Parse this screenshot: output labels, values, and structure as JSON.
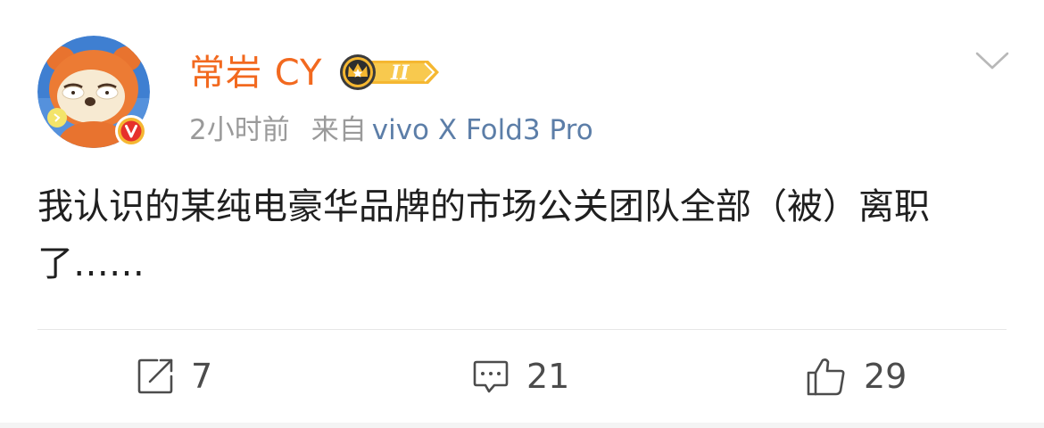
{
  "post": {
    "username": "常岩 CY",
    "member_badge": {
      "level": "II",
      "icon": "crown-icon",
      "color": "#f5b731"
    },
    "verified_badge": {
      "icon": "v-verified-icon",
      "label": "V",
      "color": "#e6312c"
    },
    "time": "2小时前",
    "source_prefix": "来自",
    "source_device": "vivo X Fold3 Pro",
    "content": "我认识的某纯电豪华品牌的市场公关团队全部（被）离职了……",
    "menu_icon": "chevron-down-icon"
  },
  "actions": {
    "repost": {
      "icon": "repost-icon",
      "count": "7"
    },
    "comment": {
      "icon": "comment-icon",
      "count": "21"
    },
    "like": {
      "icon": "thumbs-up-icon",
      "count": "29"
    }
  },
  "colors": {
    "username": "#f2691f",
    "device": "#5c7ea8",
    "meta": "#9a9a9a",
    "text": "#1f1f1f",
    "action": "#4c4c4c"
  }
}
